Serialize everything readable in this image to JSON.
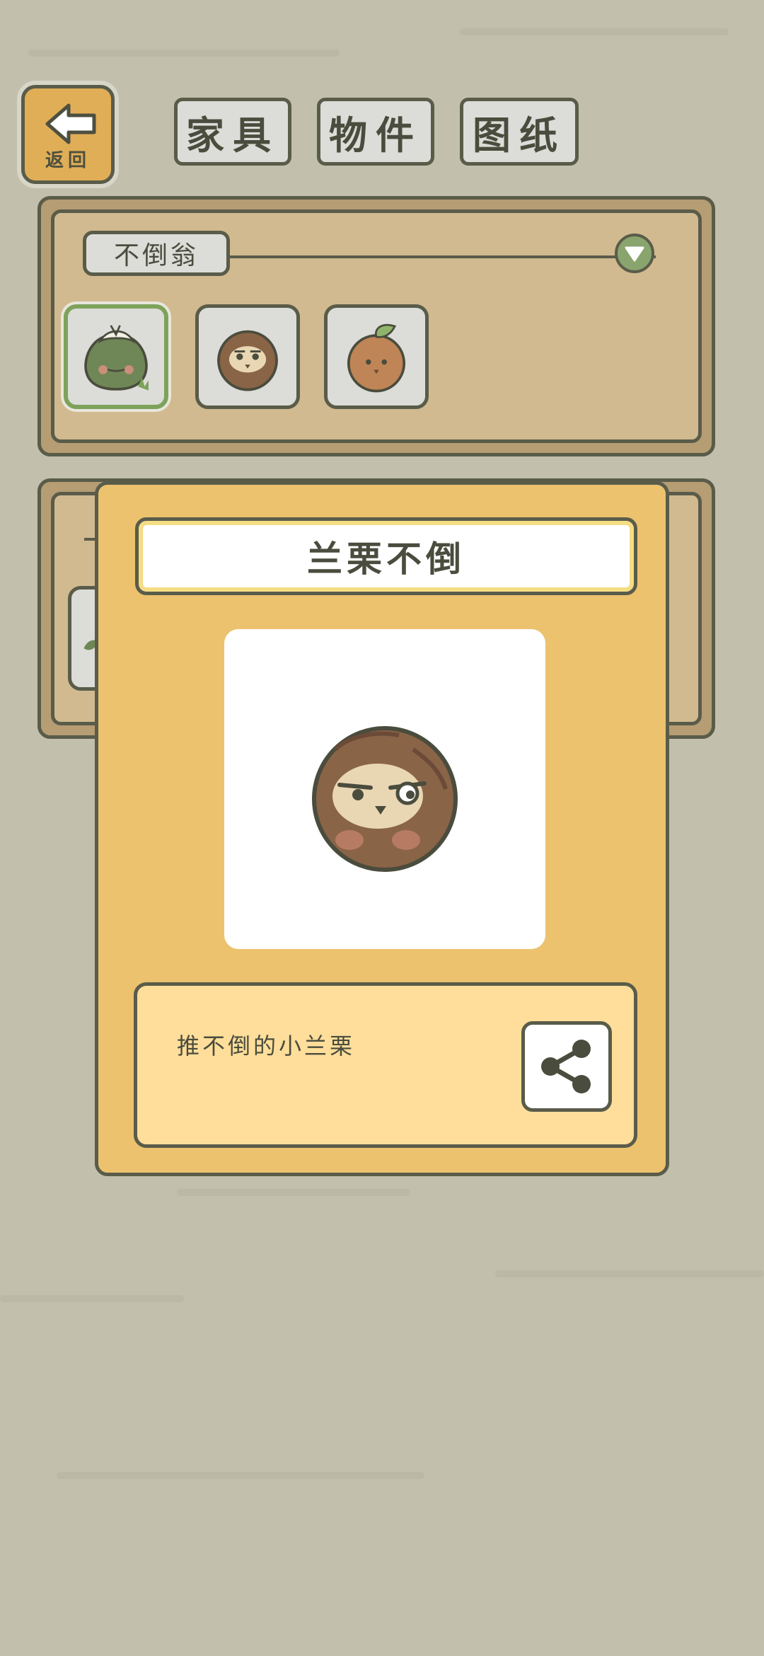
{
  "header": {
    "back_label": "返回",
    "tabs": [
      {
        "label": "家具",
        "selected": false
      },
      {
        "label": "物件",
        "selected": true
      },
      {
        "label": "图纸",
        "selected": false
      }
    ]
  },
  "category": {
    "label": "不倒翁",
    "items": [
      {
        "name": "leaf-chestnut-tumbler",
        "selected": true
      },
      {
        "name": "lanli-tumbler",
        "selected": false
      },
      {
        "name": "sprout-chestnut-tumbler",
        "selected": false
      }
    ]
  },
  "detail": {
    "title": "兰栗不倒",
    "description": "推不倒的小兰栗",
    "share_icon": "share-icon"
  },
  "colors": {
    "background": "#c2bfac",
    "panel": "#d1ba8f",
    "card": "#ecc26e",
    "description_box": "#fede9a",
    "outline": "#5a5c4a",
    "accent_green": "#8aa46d"
  }
}
